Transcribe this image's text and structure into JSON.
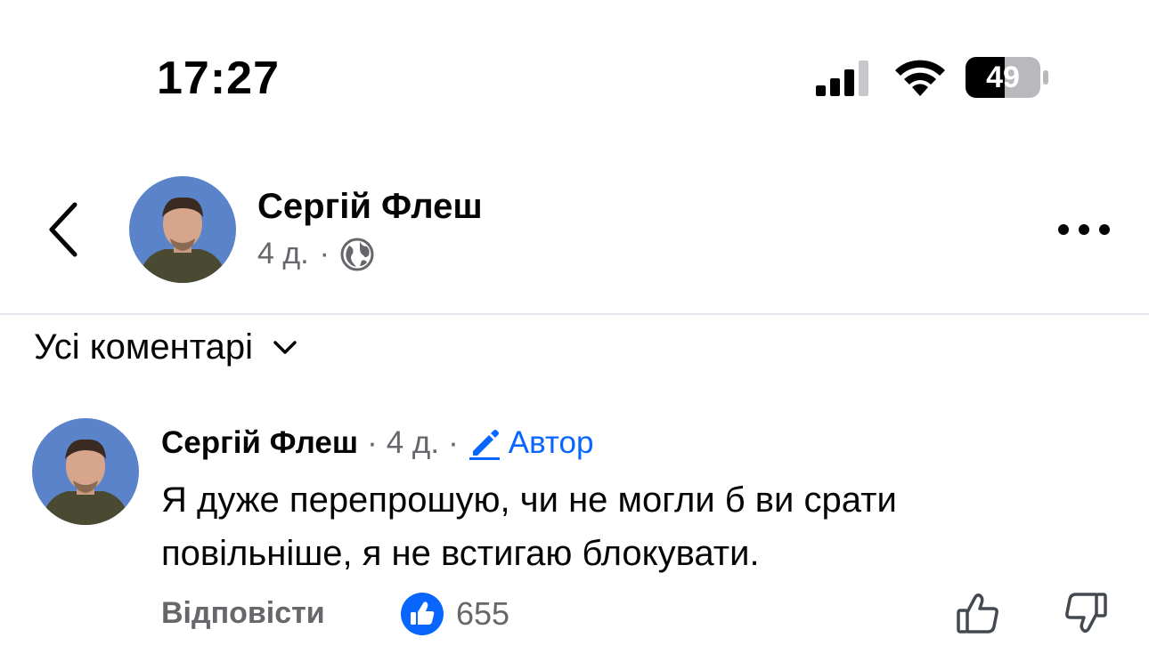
{
  "status_bar": {
    "time": "17:27",
    "battery": "49"
  },
  "header": {
    "author": "Сергій Флеш",
    "time": "4 д.",
    "separator": "·",
    "privacy_icon": "globe-icon",
    "more_icon": "more-icon",
    "back_icon": "chevron-left-icon"
  },
  "filter": {
    "label": "Усі коментарі",
    "icon": "chevron-down-icon"
  },
  "comment": {
    "author": "Сергій Флеш",
    "separator": "·",
    "time": "4 д.",
    "badge": "Автор",
    "badge_icon": "pencil-icon",
    "text": "Я дуже перепрошую, чи не могли б ви срати повільніше, я не встигаю блокувати.",
    "reply_label": "Відповісти",
    "like_count": "655",
    "like_icon": "thumbs-up-icon",
    "upvote_icon": "upvote-icon",
    "downvote_icon": "downvote-icon"
  },
  "colors": {
    "accent": "#0866ff",
    "secondary_text": "#65676b",
    "avatar_bg": "#5b83c9"
  }
}
